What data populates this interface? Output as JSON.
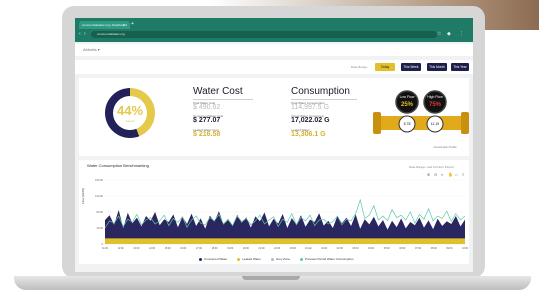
{
  "browser": {
    "tab_title": "commercialwater.org | Dashboard",
    "new_tab": "+",
    "address": "commercialwater.org",
    "nav_icons": [
      "back-icon",
      "forward-icon",
      "reload-icon"
    ]
  },
  "header": {
    "breadcrumb": "Abbotts ▾"
  },
  "period": {
    "label": "Date Range:",
    "buttons": [
      {
        "label": "Today",
        "active": true
      },
      {
        "label": "This Week",
        "active": false
      },
      {
        "label": "This Month",
        "active": false
      },
      {
        "label": "This Year",
        "active": false
      }
    ]
  },
  "savings": {
    "percent": "44%",
    "label": "Saved"
  },
  "water_cost": {
    "title": "Water Cost",
    "total_label": "Total Water Cost",
    "total_value": "$ 490.62",
    "consumed_label": "Consumed Water Cost",
    "consumed_value": "$ 277.07",
    "leaked_label": "Leaked Water Cost",
    "leaked_value": "$ 216.58"
  },
  "consumption": {
    "title": "Consumption",
    "total_label": "Total Water Consumption",
    "total_value": "114,997.5 G",
    "actual_label": "Actual Water Consumed",
    "actual_value": "17,022.02 G",
    "leaked_label": "Leaked Water",
    "leaked_value": "13,306.1 G"
  },
  "flow": {
    "low_label": "Low Flow",
    "low_value": "25%",
    "high_label": "High Flow",
    "high_value": "75%",
    "low_sub": "5.78",
    "high_sub": "11.19",
    "caption": "Consumption Profile"
  },
  "chart_section": {
    "title": "Water Consumption Benchmarking",
    "note": "Date Range: Last 24 Hour Period",
    "ylabel": "Flow (GPM)",
    "legend": [
      "Consumed Water",
      "Leaked Water",
      "Grey Zone",
      "Previous Period Water Consumption"
    ]
  },
  "chart_data": {
    "type": "area",
    "ylim": [
      0,
      160
    ],
    "yticks": [
      "160.00",
      "120.00",
      "80.00",
      "40.00",
      "0"
    ],
    "xticks": [
      "11:00",
      "12:00",
      "13:00",
      "14:00",
      "15:00",
      "16:00",
      "17:00",
      "18:00",
      "19:00",
      "20:00",
      "21:00",
      "22:00",
      "23:00",
      "24 Apr",
      "01:00",
      "02:00",
      "03:00",
      "04:00",
      "05:00",
      "06:00",
      "07:00",
      "08:00",
      "09:00",
      "10:00"
    ],
    "series": [
      {
        "name": "Consumed Water",
        "color": "#2a2660",
        "values": [
          60,
          72,
          48,
          85,
          40,
          78,
          52,
          66,
          44,
          70,
          58,
          80,
          47,
          62,
          55,
          74,
          42,
          68,
          50,
          76,
          45,
          64,
          38,
          71,
          56,
          82,
          49,
          60,
          46,
          73,
          53,
          67,
          41,
          69,
          57,
          79,
          44,
          63,
          51,
          75,
          40,
          65,
          48,
          72,
          43,
          61,
          55,
          77,
          46,
          58,
          40,
          70,
          52,
          66,
          45,
          74,
          38,
          62,
          49,
          68,
          44,
          60,
          36,
          58,
          42,
          64,
          39,
          55,
          47,
          66,
          41,
          59,
          37,
          63,
          45,
          57,
          50,
          70,
          44,
          61
        ]
      },
      {
        "name": "Leaked Water",
        "color": "#e2c02a",
        "values": [
          14,
          14,
          14,
          14,
          14,
          14,
          14,
          14,
          14,
          14,
          14,
          14,
          14,
          14,
          14,
          14,
          14,
          14,
          14,
          14,
          14,
          14,
          14,
          14,
          14,
          14,
          14,
          14,
          14,
          14,
          14,
          14,
          14,
          14,
          14,
          14,
          14,
          14,
          14,
          14,
          14,
          14,
          14,
          14,
          14,
          14,
          14,
          14,
          14,
          14,
          14,
          14,
          14,
          14,
          14,
          14,
          14,
          14,
          14,
          14,
          14,
          14,
          14,
          14,
          14,
          14,
          14,
          14,
          14,
          14,
          14,
          14,
          14,
          14,
          14,
          14,
          14,
          14,
          14,
          14
        ]
      },
      {
        "name": "Previous Period Water Consumption",
        "color": "#5fc8a8",
        "values": [
          40,
          58,
          52,
          70,
          44,
          62,
          55,
          74,
          48,
          60,
          66,
          50,
          58,
          72,
          46,
          64,
          54,
          68,
          42,
          60,
          70,
          52,
          48,
          66,
          58,
          74,
          50,
          62,
          46,
          70,
          56,
          64,
          48,
          58,
          72,
          50,
          60,
          68,
          44,
          62,
          54,
          76,
          48,
          66,
          58,
          72,
          46,
          60,
          62,
          50,
          56,
          70,
          48,
          62,
          58,
          76,
          110,
          64,
          72,
          96,
          60,
          70,
          58,
          86,
          66,
          72,
          60,
          80,
          52,
          74,
          62,
          88,
          58,
          70,
          64,
          82,
          56,
          76,
          60,
          70
        ]
      },
      {
        "name": "Grey Zone",
        "color": "#b7b7c8",
        "values": []
      }
    ]
  }
}
